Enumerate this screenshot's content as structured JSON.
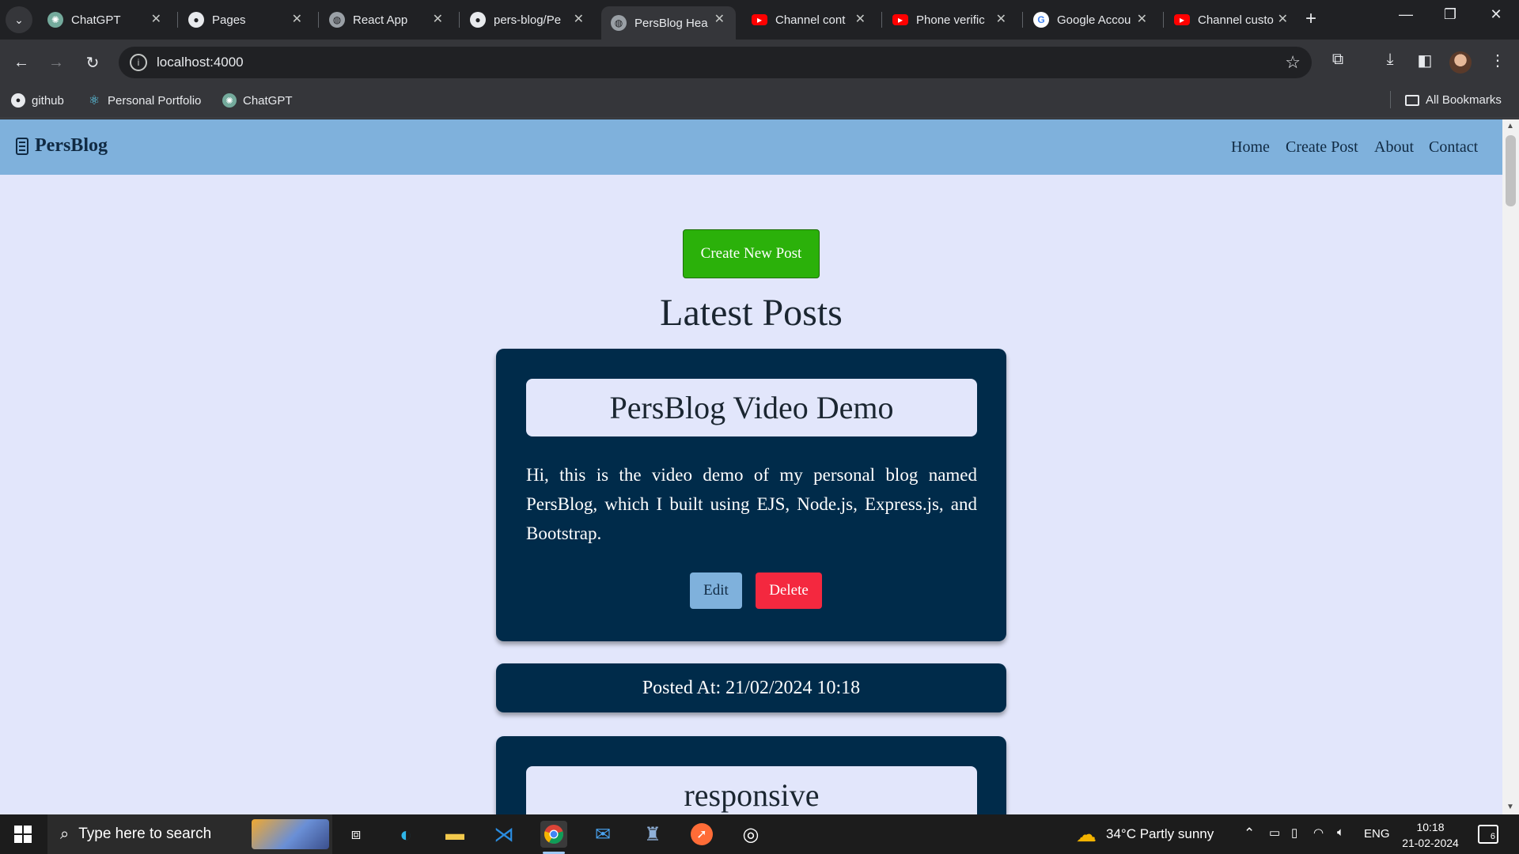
{
  "browser": {
    "tabs": [
      {
        "title": "ChatGPT",
        "icon": "chatgpt-icon"
      },
      {
        "title": "Pages",
        "icon": "github-icon"
      },
      {
        "title": "React App",
        "icon": "globe-icon"
      },
      {
        "title": "pers-blog/Pe",
        "icon": "github-icon"
      },
      {
        "title": "PersBlog Hea",
        "icon": "globe-icon",
        "active": true
      },
      {
        "title": "Channel cont",
        "icon": "youtube-icon"
      },
      {
        "title": "Phone verific",
        "icon": "youtube-icon"
      },
      {
        "title": "Google Accou",
        "icon": "google-icon"
      },
      {
        "title": "Channel custo",
        "icon": "youtube-icon"
      }
    ],
    "url": "localhost:4000",
    "bookmarks": [
      {
        "label": "github",
        "icon": "github-icon"
      },
      {
        "label": "Personal Portfolio",
        "icon": "react-icon"
      },
      {
        "label": "ChatGPT",
        "icon": "chatgpt-icon"
      }
    ],
    "all_bookmarks_label": "All Bookmarks"
  },
  "site": {
    "brand": "PersBlog",
    "nav": [
      "Home",
      "Create Post",
      "About",
      "Contact"
    ],
    "create_button": "Create New Post",
    "heading": "Latest Posts",
    "posts": [
      {
        "title": "PersBlog Video Demo",
        "body": "Hi, this is the video demo of my personal blog named PersBlog, which I built using EJS, Node.js, Express.js, and Bootstrap.",
        "edit_label": "Edit",
        "delete_label": "Delete",
        "posted_at": "Posted At: 21/02/2024 10:18"
      },
      {
        "title": "responsive"
      }
    ]
  },
  "taskbar": {
    "search_placeholder": "Type here to search",
    "weather": "34°C  Partly sunny",
    "language": "ENG",
    "time": "10:18",
    "date": "21-02-2024",
    "notification_count": "6"
  },
  "colors": {
    "nav_bg": "#7fb1dc",
    "page_bg": "#e2e6fb",
    "card_bg": "#002b4a",
    "create_btn": "#2bb10a",
    "delete_btn": "#f4283f"
  }
}
